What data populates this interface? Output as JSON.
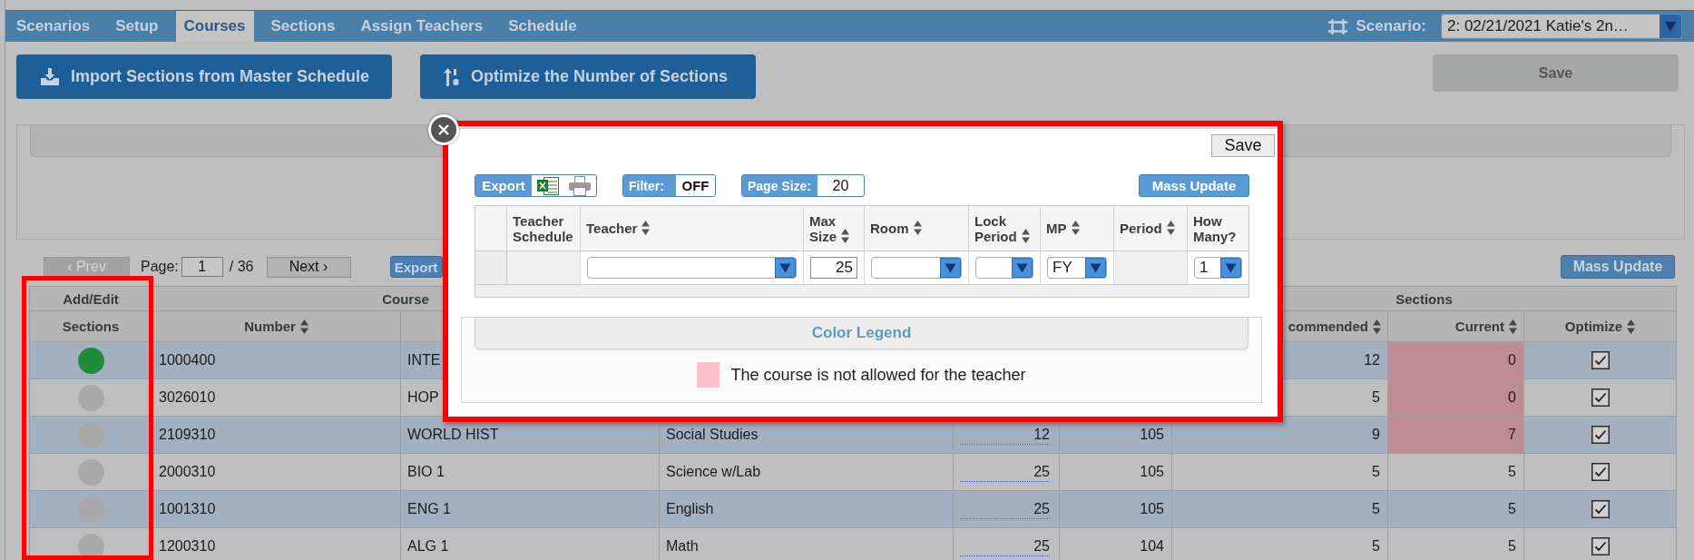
{
  "tabs": [
    {
      "label": "Scenarios",
      "selected": false
    },
    {
      "label": "Setup",
      "selected": false
    },
    {
      "label": "Courses",
      "selected": true
    },
    {
      "label": "Sections",
      "selected": false
    },
    {
      "label": "Assign Teachers",
      "selected": false
    },
    {
      "label": "Schedule",
      "selected": false
    }
  ],
  "scenario": {
    "label": "Scenario:",
    "value": "2: 02/21/2021 Katie's 2n…"
  },
  "toolbar": {
    "buttons": [
      {
        "kind": "import",
        "label": "Import Sections from Master Schedule"
      },
      {
        "kind": "optimize",
        "label": "Optimize the Number of Sections"
      }
    ],
    "save": {
      "label": "Save",
      "disabled": true
    }
  },
  "pager": {
    "prev": {
      "label": "‹ Prev",
      "disabled": true
    },
    "page_label": "Page:",
    "page": "1",
    "total": "/ 36",
    "next": {
      "label": "Next ›",
      "disabled": false
    },
    "export": "Export",
    "mass_update": "Mass Update"
  },
  "table": {
    "header_groups": [
      {
        "label": "Add/Edit",
        "highlighted": true,
        "columns": [
          {
            "kind": "status",
            "label": "Sections",
            "sortable": false
          }
        ]
      },
      {
        "label": "Course",
        "columns": [
          {
            "kind": "text",
            "label": "Number",
            "sortable": true
          },
          {
            "kind": "text"
          }
        ]
      },
      {
        "columns": [
          {
            "kind": "text"
          },
          {
            "kind": "input"
          },
          {
            "kind": "number"
          }
        ]
      },
      {
        "label": "Sections",
        "columns": [
          {
            "kind": "number",
            "label": "commended",
            "sortable": true
          },
          {
            "kind": "marked",
            "label": "Current",
            "sortable": true
          },
          {
            "kind": "check",
            "label": "Optimize",
            "sortable": true
          }
        ]
      }
    ],
    "rows": [
      {
        "color": "#1f8d3a",
        "cells": [
          "1000400",
          "INTE",
          null,
          null,
          null,
          "12",
          {
            "text": "0",
            "highlighted": true
          },
          true
        ]
      },
      {
        "color": "#a9a9a9",
        "cells": [
          "3026010",
          "HOP",
          null,
          null,
          null,
          "5",
          {
            "text": "0",
            "highlighted": true
          },
          true
        ]
      },
      {
        "color": "#a9a9a9",
        "cells": [
          "2109310",
          "WORLD HIST",
          "Social Studies",
          "12",
          "105",
          "9",
          {
            "text": "7",
            "highlighted": true
          },
          true
        ]
      },
      {
        "color": "#a9a9a9",
        "cells": [
          "2000310",
          "BIO 1",
          "Science w/Lab",
          "25",
          "105",
          "5",
          {
            "text": "5",
            "highlighted": false
          },
          true
        ]
      },
      {
        "color": "#a9a9a9",
        "cells": [
          "1001310",
          "ENG 1",
          "English",
          "25",
          "105",
          "5",
          {
            "text": "5",
            "highlighted": false
          },
          true
        ]
      },
      {
        "color": "#a9a9a9",
        "cells": [
          "1200310",
          "ALG 1",
          "Math",
          "25",
          "104",
          "5",
          {
            "text": "5",
            "highlighted": false
          },
          true
        ]
      }
    ]
  },
  "dialog": {
    "highlighted": true,
    "save": "Save",
    "toolbar": {
      "export": "Export",
      "filter": {
        "label": "Filter:",
        "value": "OFF"
      },
      "page_size": {
        "label": "Page Size:",
        "value": "20"
      },
      "mass_update": "Mass Update"
    },
    "table": {
      "columns": [
        {
          "label": "Teacher Schedule",
          "sortable": false
        },
        {
          "label": "Teacher",
          "sortable": true
        },
        {
          "label": "Max Size",
          "sortable": true
        },
        {
          "label": "Room",
          "sortable": true
        },
        {
          "label": "Lock Period",
          "sortable": true
        },
        {
          "label": "MP",
          "sortable": true
        },
        {
          "label": "Period",
          "sortable": true
        },
        {
          "label": "How Many?",
          "sortable": false
        }
      ],
      "row": [
        {
          "kind": "blank"
        },
        {
          "kind": "select"
        },
        {
          "kind": "input",
          "value": "25"
        },
        {
          "kind": "select"
        },
        {
          "kind": "select"
        },
        {
          "kind": "select",
          "value": "FY"
        },
        {
          "kind": "blank"
        },
        {
          "kind": "select",
          "value": "1"
        }
      ]
    },
    "legend": {
      "title": "Color Legend",
      "items": [
        {
          "color": "#ffc0cb",
          "label": "The course is not allowed for the teacher"
        }
      ]
    }
  }
}
